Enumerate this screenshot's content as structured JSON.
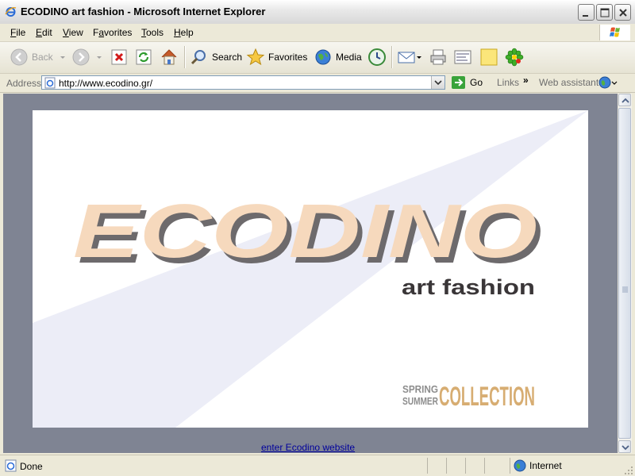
{
  "window": {
    "title": "ECODINO art fashion - Microsoft Internet Explorer"
  },
  "menu": [
    {
      "label": "File",
      "key": "F"
    },
    {
      "label": "Edit",
      "key": "E"
    },
    {
      "label": "View",
      "key": "V"
    },
    {
      "label": "Favorites",
      "key": "a"
    },
    {
      "label": "Tools",
      "key": "T"
    },
    {
      "label": "Help",
      "key": "H"
    }
  ],
  "toolbar": {
    "back_label": "Back",
    "search_label": "Search",
    "favorites_label": "Favorites",
    "media_label": "Media"
  },
  "address": {
    "label": "Address",
    "url": "http://www.ecodino.gr/",
    "go_label": "Go",
    "links_label": "Links",
    "web_assistant_label": "Web assistant"
  },
  "page": {
    "logo_text": "ECODINO",
    "tagline": "art fashion",
    "collection_season_1": "SPRING",
    "collection_season_2": "SUMMER",
    "collection_word": "COLLECTION",
    "enter_link": "enter Ecodino website"
  },
  "status": {
    "text": "Done",
    "zone": "Internet"
  },
  "colors": {
    "logo_fill": "#f6d9bd",
    "logo_shadow": "#6d6a6c",
    "tagline": "#3a3638",
    "collection_gold": "#d7ad72",
    "collection_gray": "#8d8d8d",
    "beam": "#eceef8",
    "page_bg": "#7f8493",
    "link": "#00009c"
  }
}
